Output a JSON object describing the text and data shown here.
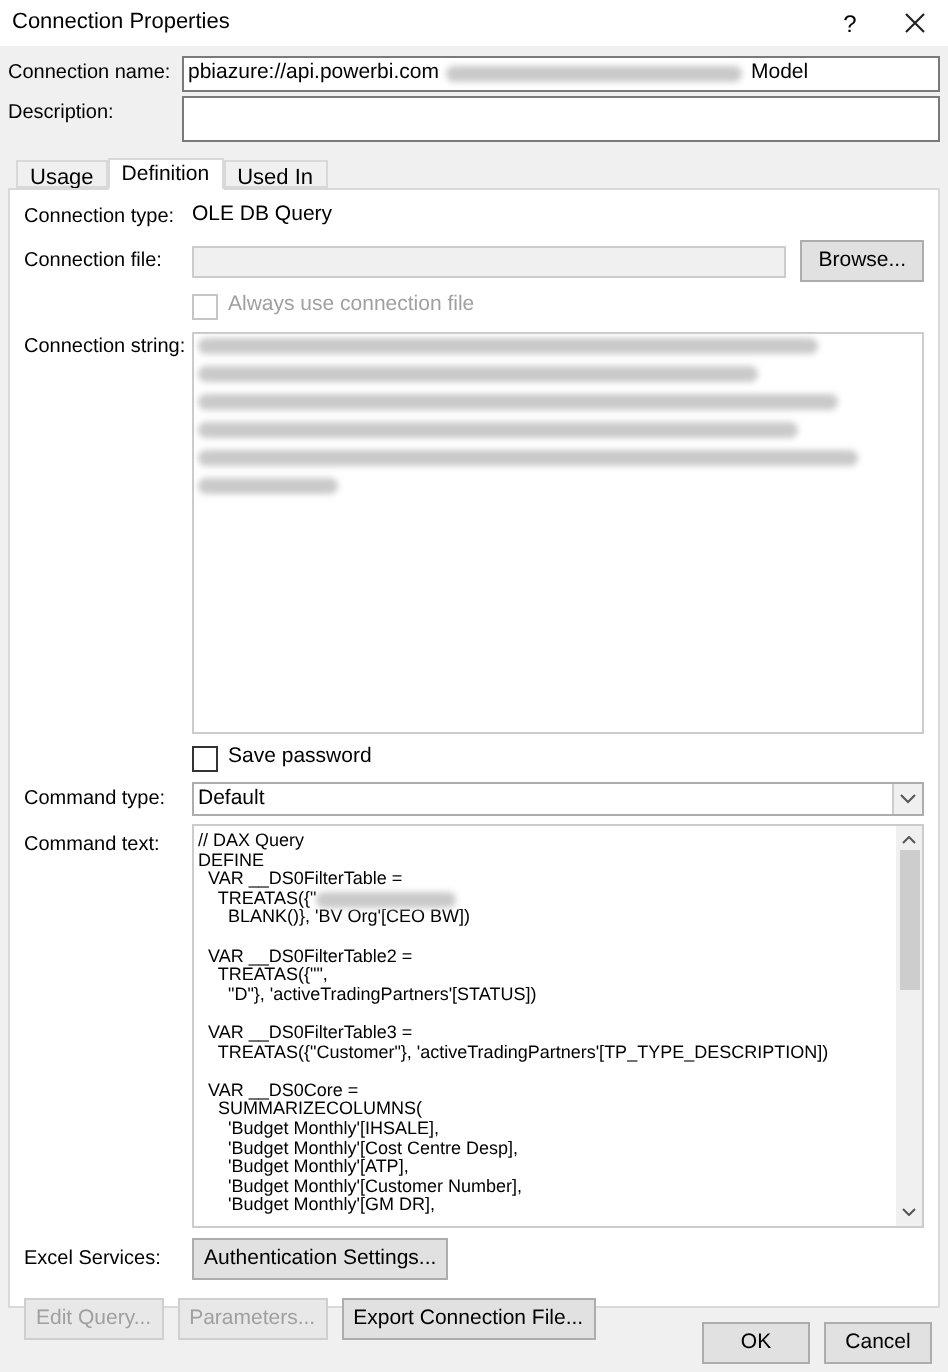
{
  "window": {
    "title": "Connection Properties",
    "help": "?"
  },
  "connection_name": {
    "label": "Connection name:",
    "value_start": "pbiazure://api.powerbi.com",
    "value_end": "Model"
  },
  "description": {
    "label": "Description:"
  },
  "tabs": [
    {
      "label": "Usage",
      "selected": false
    },
    {
      "label": "Definition",
      "selected": true
    },
    {
      "label": "Used In",
      "selected": false
    }
  ],
  "connection_type": {
    "label": "Connection type:",
    "value": "OLE DB Query"
  },
  "connection_file": {
    "label": "Connection file:",
    "button": "Browse..."
  },
  "always_use_file": {
    "label": "Always use connection file",
    "checked": false,
    "disabled": true
  },
  "connection_string": {
    "label": "Connection string:"
  },
  "save_password": {
    "label": "Save password",
    "checked": false
  },
  "command_type": {
    "label": "Command type:",
    "value": "Default"
  },
  "command_text": {
    "label": "Command text:",
    "blocks": [
      [
        [
          {
            "kind": "text",
            "text": "// DAX Query"
          }
        ],
        [
          {
            "kind": "text",
            "text": "DEFINE"
          }
        ],
        [
          {
            "kind": "text",
            "text": "  VAR __DS0FilterTable ="
          }
        ],
        [
          {
            "kind": "text",
            "text": "    TREATAS({\""
          },
          {
            "kind": "blurred"
          }
        ],
        [
          {
            "kind": "text",
            "text": "      BLANK()}, 'BV Org'[CEO BW])"
          }
        ]
      ],
      [
        [
          {
            "kind": "text",
            "text": "  VAR __DS0FilterTable2 ="
          }
        ],
        [
          {
            "kind": "text",
            "text": "    TREATAS({\"\","
          }
        ],
        [
          {
            "kind": "text",
            "text": "      \"D\"}, 'activeTradingPartners'[STATUS])"
          }
        ]
      ],
      [
        [
          {
            "kind": "text",
            "text": "  VAR __DS0FilterTable3 ="
          }
        ],
        [
          {
            "kind": "text",
            "text": "    TREATAS({\"Customer\"}, 'activeTradingPartners'[TP_TYPE_DESCRIPTION])"
          }
        ]
      ],
      [
        [
          {
            "kind": "text",
            "text": "  VAR __DS0Core ="
          }
        ],
        [
          {
            "kind": "text",
            "text": "    SUMMARIZECOLUMNS("
          }
        ],
        [
          {
            "kind": "text",
            "text": "      'Budget Monthly'[IHSALE],"
          }
        ],
        [
          {
            "kind": "text",
            "text": "      'Budget Monthly'[Cost Centre Desp],"
          }
        ],
        [
          {
            "kind": "text",
            "text": "      'Budget Monthly'[ATP],"
          }
        ],
        [
          {
            "kind": "text",
            "text": "      'Budget Monthly'[Customer Number],"
          }
        ],
        [
          {
            "kind": "text",
            "text": "      'Budget Monthly'[GM DR],"
          }
        ]
      ]
    ]
  },
  "excel_services": {
    "label": "Excel Services:",
    "button": "Authentication Settings..."
  },
  "action_buttons": [
    {
      "label": "Edit Query...",
      "disabled": true
    },
    {
      "label": "Parameters...",
      "disabled": true
    },
    {
      "label": "Export Connection File...",
      "disabled": false
    }
  ],
  "dialog_buttons": [
    "OK",
    "Cancel"
  ]
}
